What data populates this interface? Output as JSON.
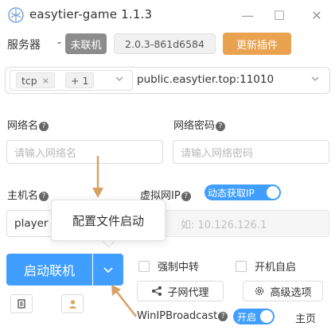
{
  "window": {
    "title": "easytier-game 1.1.3",
    "minimize_glyph": "—",
    "maximize_glyph": "☐",
    "close_glyph": "✕"
  },
  "server": {
    "label": "服务器",
    "dash": "-",
    "status": "未联机",
    "version": "2.0.3-861d6584",
    "update_button": "更新插件"
  },
  "protocol": {
    "tag": "tcp",
    "tag_remove": "×",
    "more_tag": "+ 1",
    "server_url": "public.easytier.top:11010"
  },
  "network": {
    "name_label": "网络名",
    "name_placeholder": "请输入网络名",
    "password_label": "网络密码",
    "password_placeholder": "请输入网络密码",
    "host_label": "主机名",
    "host_value": "player",
    "ip_label": "虚拟网IP",
    "dynamic_ip_toggle": "动态获取IP",
    "ip_placeholder": "如: 10.126.126.1"
  },
  "tooltip": {
    "text": "配置文件启动"
  },
  "actions": {
    "start_button": "启动联机",
    "force_relay": "强制中转",
    "autostart": "开机自启",
    "subnet_proxy": "子网代理",
    "advanced": "高级选项",
    "winip_label": "WinIPBroadcast",
    "winip_toggle": "开启",
    "home": "主页"
  },
  "colors": {
    "accent": "#409eff",
    "update": "#e9a24f",
    "status_offline": "#8c8c8c",
    "annotation_arrow": "#d9a064"
  },
  "icons": {
    "app_logo": "app-logo-icon",
    "help": "help-circle-icon",
    "chevron": "chevron-down-icon",
    "share": "share-icon",
    "gear": "gear-icon",
    "document": "document-icon",
    "user": "user-icon"
  }
}
